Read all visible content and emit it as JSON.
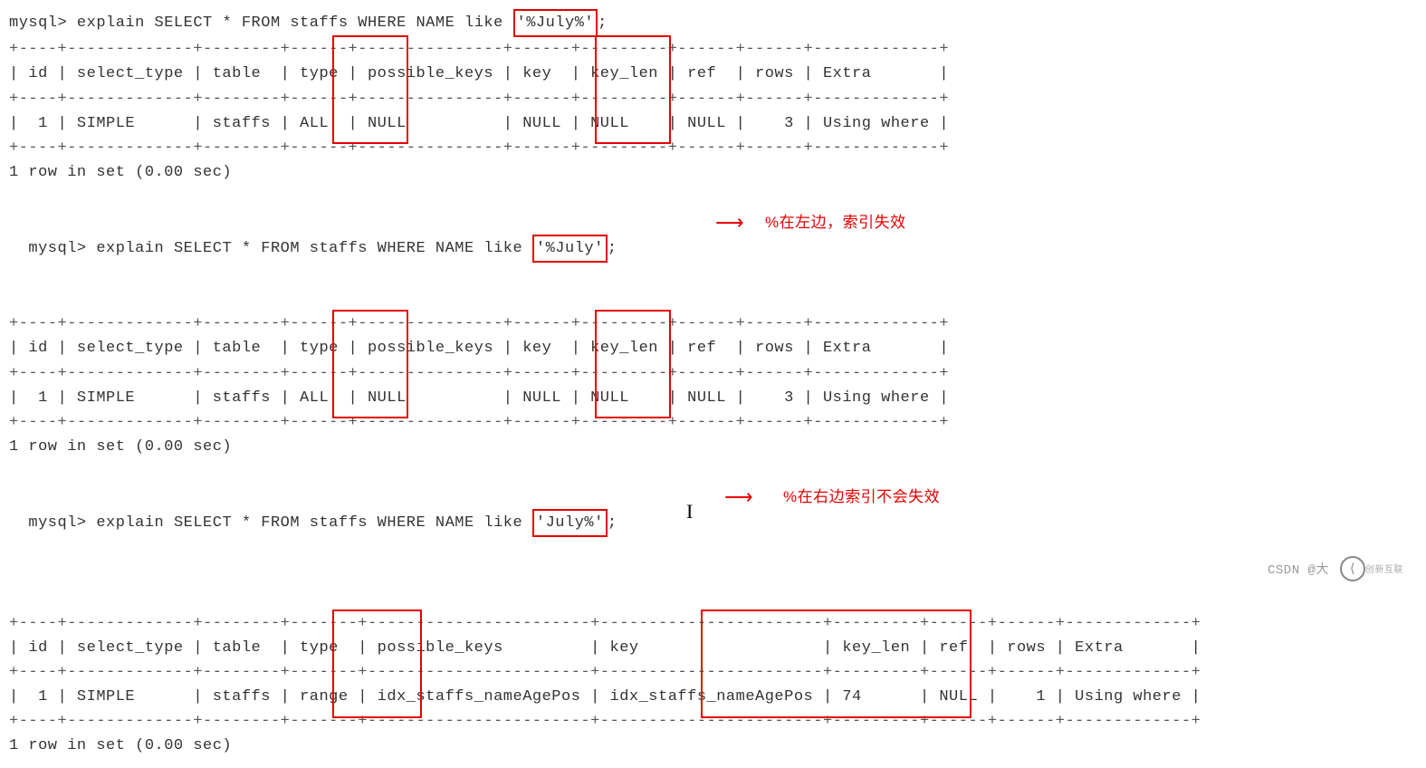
{
  "queries": [
    {
      "prompt": "mysql>",
      "sql_prefix": " explain SELECT * FROM staffs WHERE NAME like ",
      "like_value": "'%July%'",
      "sql_suffix": ";",
      "headers": [
        "id",
        "select_type",
        "table",
        "type",
        "possible_keys",
        "key",
        "key_len",
        "ref",
        "rows",
        "Extra"
      ],
      "row": [
        "1",
        "SIMPLE",
        "staffs",
        "ALL",
        "NULL",
        "NULL",
        "NULL",
        "NULL",
        "3",
        "Using where"
      ],
      "status": "1 row in set (0.00 sec)",
      "annotation": ""
    },
    {
      "prompt": "mysql>",
      "sql_prefix": " explain SELECT * FROM staffs WHERE NAME like ",
      "like_value": "'%July'",
      "sql_suffix": ";",
      "headers": [
        "id",
        "select_type",
        "table",
        "type",
        "possible_keys",
        "key",
        "key_len",
        "ref",
        "rows",
        "Extra"
      ],
      "row": [
        "1",
        "SIMPLE",
        "staffs",
        "ALL",
        "NULL",
        "NULL",
        "NULL",
        "NULL",
        "3",
        "Using where"
      ],
      "status": "1 row in set (0.00 sec)",
      "annotation": "%在左边，索引失效"
    },
    {
      "prompt": "mysql>",
      "sql_prefix": " explain SELECT * FROM staffs WHERE NAME like ",
      "like_value": "'July%'",
      "sql_suffix": ";",
      "headers": [
        "id",
        "select_type",
        "table",
        "type",
        "possible_keys",
        "key",
        "key_len",
        "ref",
        "rows",
        "Extra"
      ],
      "row": [
        "1",
        "SIMPLE",
        "staffs",
        "range",
        "idx_staffs_nameAgePos",
        "idx_staffs_nameAgePos",
        "74",
        "NULL",
        "1",
        "Using where"
      ],
      "status": "1 row in set (0.00 sec)",
      "annotation": "%在右边索引不会失效"
    }
  ],
  "watermark_left": "CSDN @大",
  "watermark_right": "创新互联"
}
